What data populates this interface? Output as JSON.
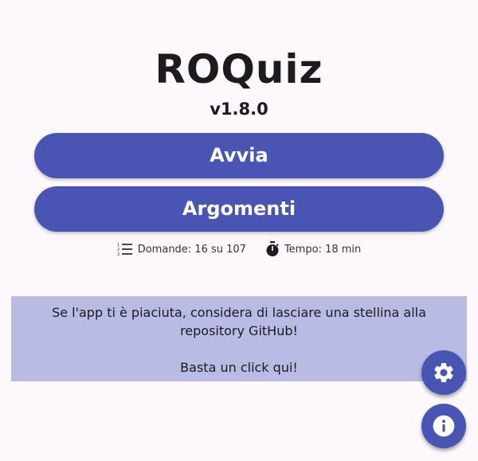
{
  "app": {
    "title": "ROQuiz",
    "version": "v1.8.0"
  },
  "buttons": {
    "start_label": "Avvia",
    "topics_label": "Argomenti"
  },
  "info": {
    "questions_text": "Domande: 16 su 107",
    "time_text": "Tempo: 18 min",
    "questions_icon": "numbered-list-icon",
    "time_icon": "stopwatch-icon"
  },
  "banner": {
    "message": "Se l'app ti è piaciuta, considera di lasciare una stellina alla repository GitHub!",
    "cta": "Basta un click qui!"
  },
  "fabs": {
    "settings_icon": "gear-icon",
    "info_icon": "info-icon"
  },
  "colors": {
    "primary": "#4955b3",
    "banner_bg": "#b8bbe3",
    "background": "#fdf8fc"
  }
}
